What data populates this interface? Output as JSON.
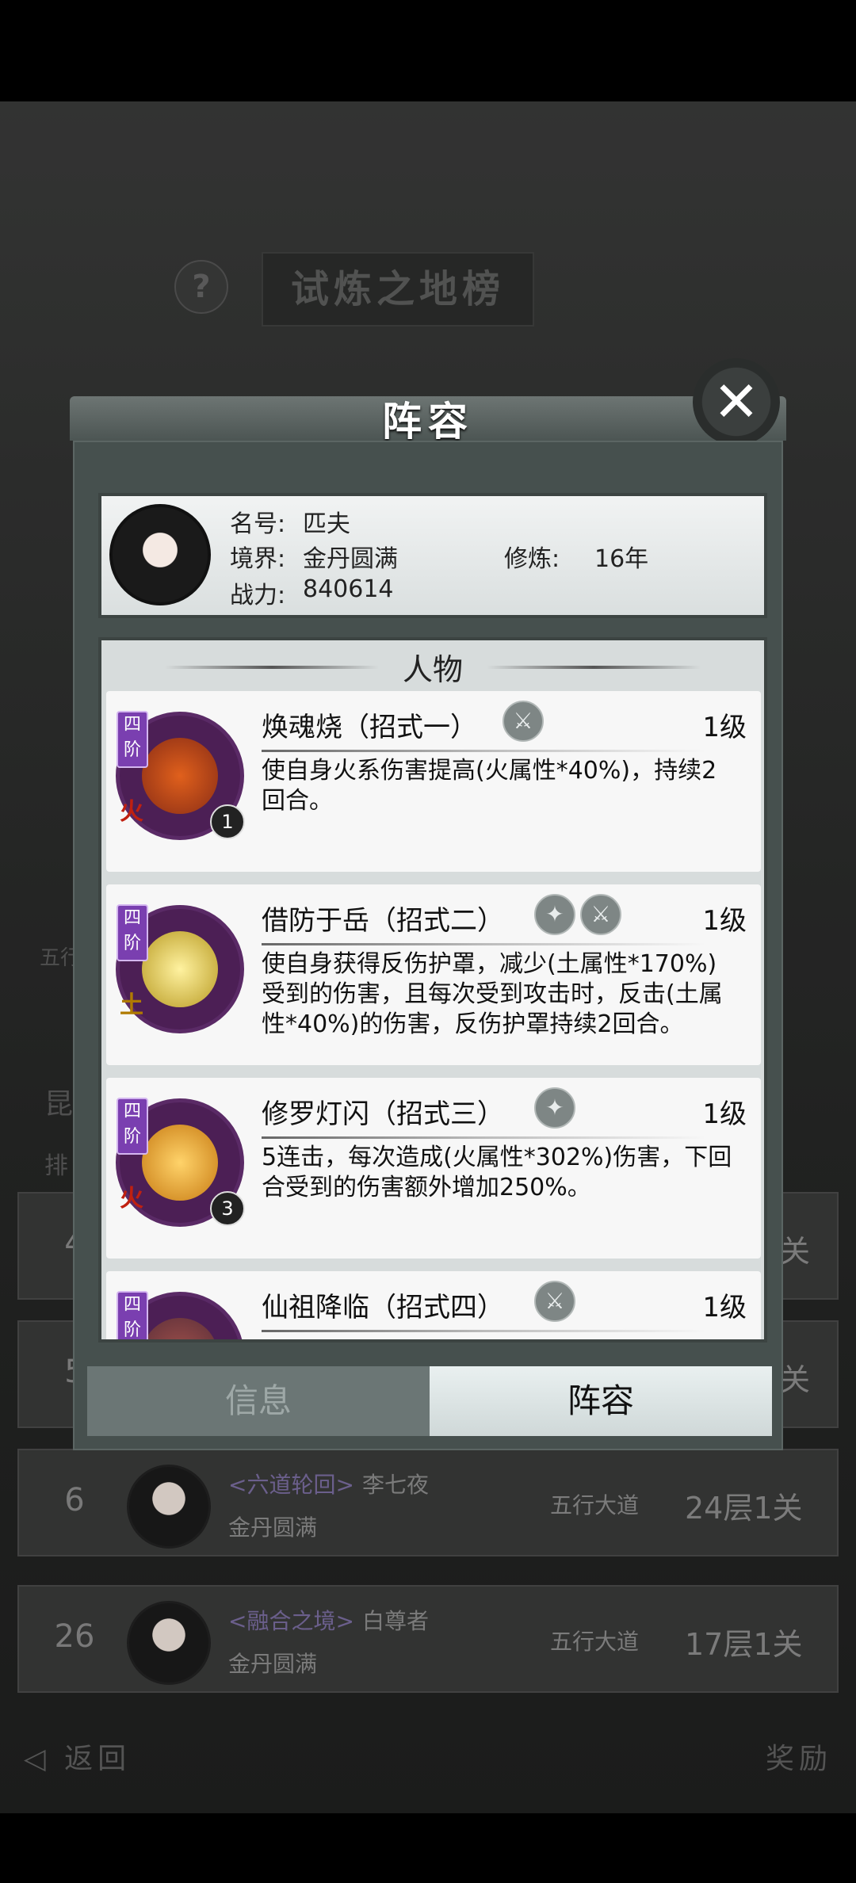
{
  "background": {
    "title": "试炼之地榜",
    "help_icon": "?",
    "side_label_1": "五行",
    "side_label_2": "昆",
    "side_label_3": "排",
    "rows_partial": [
      {
        "rank": "4",
        "stage": "关"
      },
      {
        "rank": "5",
        "stage": "关"
      }
    ],
    "rows": [
      {
        "rank": "6",
        "sect": "<六道轮回>",
        "name": "李七夜",
        "realm": "金丹圆满",
        "family": "五行大道",
        "stage": "24层1关"
      },
      {
        "rank": "26",
        "sect": "<融合之境>",
        "name": "白尊者",
        "realm": "金丹圆满",
        "family": "五行大道",
        "stage": "17层1关"
      }
    ],
    "back_label": "返回",
    "reward_label": "奖励"
  },
  "dialog": {
    "title": "阵容",
    "close_icon": "✕",
    "profile": {
      "name_label": "名号:",
      "name": "匹夫",
      "realm_label": "境界:",
      "realm": "金丹圆满",
      "cultivation_label": "修炼:",
      "cultivation": "16年",
      "power_label": "战力:",
      "power": "840614"
    },
    "section_title": "人物",
    "skills": [
      {
        "tier": "四阶",
        "element": "火",
        "count": "1",
        "name": "焕魂烧（招式一）",
        "badges": [
          "⚔"
        ],
        "level": "1级",
        "desc": "使自身火系伤害提高(火属性*40%)，持续2回合。",
        "core_color": "#8a2d15"
      },
      {
        "tier": "四阶",
        "element": "土",
        "count": "",
        "name": "借防于岳（招式二）",
        "badges": [
          "✦",
          "⚔"
        ],
        "level": "1级",
        "desc": "使自身获得反伤护罩，减少(土属性*170%)受到的伤害，且每次受到攻击时，反击(土属性*40%)的伤害，反伤护罩持续2回合。",
        "core_color": "#b89a22"
      },
      {
        "tier": "四阶",
        "element": "火",
        "count": "3",
        "name": "修罗灯闪（招式三）",
        "badges": [
          "✦"
        ],
        "level": "1级",
        "desc": "5连击，每次造成(火属性*302%)伤害，下回合受到的伤害额外增加250%。",
        "core_color": "#c77a12"
      },
      {
        "tier": "四阶",
        "element": "",
        "count": "",
        "name": "仙祖降临（招式四）",
        "badges": [
          "⚔"
        ],
        "level": "1级",
        "desc": "",
        "core_color": "#5b2f3a"
      }
    ],
    "tabs": {
      "info": "信息",
      "lineup": "阵容"
    }
  }
}
